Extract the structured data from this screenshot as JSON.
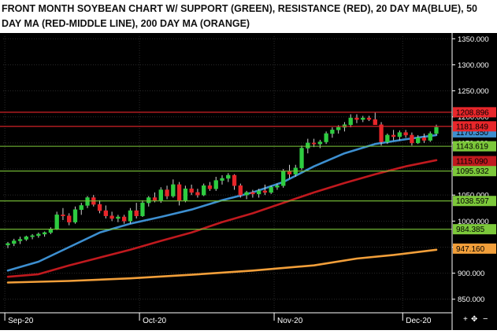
{
  "header": {
    "title": "FRONT MONTH SOYBEAN CHART W/ SUPPORT (GREEN), RESISTANCE (RED), 20 DAY MA(BLUE), 50 DAY MA (RED-MIDDLE LINE), 200 DAY MA (ORANGE)"
  },
  "chart_data": {
    "type": "candlestick",
    "title": "FRONT MONTH SOYBEAN CHART W/ SUPPORT (GREEN), RESISTANCE (RED), 20 DAY MA(BLUE), 50 DAY MA (RED-MIDDLE LINE), 200 DAY MA (ORANGE)",
    "ylim": [
      830,
      1355
    ],
    "y_ticks": [
      "850.000",
      "900.000",
      "950.000",
      "1000.000",
      "1050.000",
      "1100.000",
      "1150.000",
      "1200.000",
      "1250.000",
      "1300.000",
      "1350.000"
    ],
    "x_ticks": [
      {
        "label": "Sep-20",
        "index": 0
      },
      {
        "label": "Oct-20",
        "index": 22
      },
      {
        "label": "Nov-20",
        "index": 44
      },
      {
        "label": "Dec-20",
        "index": 65
      }
    ],
    "grid": true,
    "candle_up_color": "#2ecc40",
    "candle_down_color": "#e8262a",
    "candles": [
      [
        954,
        960,
        948,
        957
      ],
      [
        957,
        966,
        952,
        962
      ],
      [
        962,
        970,
        956,
        965
      ],
      [
        965,
        972,
        962,
        970
      ],
      [
        970,
        975,
        965,
        972
      ],
      [
        972,
        978,
        968,
        975
      ],
      [
        975,
        980,
        970,
        978
      ],
      [
        978,
        988,
        975,
        985
      ],
      [
        985,
        1018,
        983,
        1012
      ],
      [
        1012,
        1025,
        1002,
        1010
      ],
      [
        1010,
        1015,
        992,
        998
      ],
      [
        998,
        1028,
        995,
        1022
      ],
      [
        1022,
        1035,
        1012,
        1030
      ],
      [
        1030,
        1048,
        1025,
        1045
      ],
      [
        1045,
        1050,
        1028,
        1032
      ],
      [
        1032,
        1040,
        1015,
        1020
      ],
      [
        1020,
        1030,
        1005,
        1010
      ],
      [
        1010,
        1018,
        1000,
        1005
      ],
      [
        1005,
        1012,
        998,
        1008
      ],
      [
        1008,
        1012,
        995,
        1000
      ],
      [
        1000,
        1025,
        995,
        1020
      ],
      [
        1020,
        1035,
        1005,
        1010
      ],
      [
        1010,
        1040,
        1008,
        1035
      ],
      [
        1035,
        1048,
        1028,
        1045
      ],
      [
        1045,
        1055,
        1036,
        1040
      ],
      [
        1040,
        1065,
        1035,
        1060
      ],
      [
        1060,
        1068,
        1042,
        1048
      ],
      [
        1048,
        1080,
        1045,
        1070
      ],
      [
        1070,
        1075,
        1030,
        1040
      ],
      [
        1040,
        1068,
        1036,
        1062
      ],
      [
        1062,
        1070,
        1050,
        1055
      ],
      [
        1055,
        1062,
        1045,
        1050
      ],
      [
        1050,
        1072,
        1048,
        1068
      ],
      [
        1068,
        1075,
        1058,
        1062
      ],
      [
        1062,
        1085,
        1058,
        1078
      ],
      [
        1078,
        1088,
        1070,
        1082
      ],
      [
        1082,
        1092,
        1075,
        1088
      ],
      [
        1088,
        1090,
        1060,
        1068
      ],
      [
        1068,
        1072,
        1045,
        1050
      ],
      [
        1050,
        1058,
        1042,
        1055
      ],
      [
        1055,
        1060,
        1045,
        1052
      ],
      [
        1052,
        1062,
        1045,
        1058
      ],
      [
        1058,
        1070,
        1050,
        1055
      ],
      [
        1055,
        1068,
        1052,
        1065
      ],
      [
        1065,
        1072,
        1060,
        1068
      ],
      [
        1068,
        1100,
        1064,
        1095
      ],
      [
        1095,
        1108,
        1082,
        1090
      ],
      [
        1090,
        1108,
        1085,
        1102
      ],
      [
        1102,
        1145,
        1098,
        1140
      ],
      [
        1140,
        1158,
        1130,
        1150
      ],
      [
        1150,
        1158,
        1142,
        1148
      ],
      [
        1148,
        1156,
        1140,
        1152
      ],
      [
        1152,
        1172,
        1148,
        1168
      ],
      [
        1168,
        1180,
        1160,
        1175
      ],
      [
        1175,
        1184,
        1168,
        1180
      ],
      [
        1180,
        1190,
        1172,
        1185
      ],
      [
        1185,
        1205,
        1180,
        1198
      ],
      [
        1198,
        1205,
        1188,
        1195
      ],
      [
        1195,
        1202,
        1190,
        1198
      ],
      [
        1198,
        1202,
        1192,
        1195
      ],
      [
        1195,
        1208,
        1190,
        1185
      ],
      [
        1185,
        1190,
        1145,
        1152
      ],
      [
        1152,
        1168,
        1148,
        1165
      ],
      [
        1165,
        1175,
        1155,
        1162
      ],
      [
        1162,
        1174,
        1155,
        1170
      ],
      [
        1170,
        1175,
        1160,
        1165
      ],
      [
        1165,
        1170,
        1145,
        1150
      ],
      [
        1150,
        1165,
        1148,
        1160
      ],
      [
        1160,
        1168,
        1150,
        1155
      ],
      [
        1155,
        1172,
        1152,
        1168
      ],
      [
        1168,
        1185,
        1165,
        1180
      ]
    ],
    "moving_averages": [
      {
        "name": "20 DAY MA",
        "color": "#3d8fd0",
        "points": [
          [
            0,
            905
          ],
          [
            5,
            922
          ],
          [
            10,
            950
          ],
          [
            15,
            978
          ],
          [
            20,
            995
          ],
          [
            25,
            1008
          ],
          [
            30,
            1022
          ],
          [
            35,
            1040
          ],
          [
            40,
            1055
          ],
          [
            45,
            1075
          ],
          [
            50,
            1105
          ],
          [
            55,
            1130
          ],
          [
            60,
            1148
          ],
          [
            65,
            1157
          ],
          [
            70,
            1165
          ]
        ]
      },
      {
        "name": "50 DAY MA",
        "color": "#c0191e",
        "points": [
          [
            0,
            893
          ],
          [
            5,
            898
          ],
          [
            10,
            915
          ],
          [
            15,
            930
          ],
          [
            20,
            945
          ],
          [
            25,
            962
          ],
          [
            30,
            978
          ],
          [
            35,
            998
          ],
          [
            40,
            1015
          ],
          [
            45,
            1035
          ],
          [
            50,
            1055
          ],
          [
            55,
            1073
          ],
          [
            60,
            1090
          ],
          [
            65,
            1105
          ],
          [
            70,
            1117
          ]
        ]
      },
      {
        "name": "200 DAY MA",
        "color": "#f29f3a",
        "points": [
          [
            0,
            882
          ],
          [
            10,
            885
          ],
          [
            20,
            890
          ],
          [
            30,
            897
          ],
          [
            40,
            905
          ],
          [
            50,
            915
          ],
          [
            57,
            928
          ],
          [
            63,
            935
          ],
          [
            70,
            945
          ]
        ]
      }
    ],
    "resistance_lines": [
      {
        "value": 1208.896,
        "label": "1208.896",
        "color": "#e8262a"
      },
      {
        "value": 1181.849,
        "label": "1181.849",
        "color": "#e8262a"
      }
    ],
    "support_lines": [
      {
        "value": 1143.619,
        "label": "1143.619",
        "color": "#7cc83a"
      },
      {
        "value": 1095.932,
        "label": "1095.932",
        "color": "#7cc83a"
      },
      {
        "value": 1038.597,
        "label": "1038.597",
        "color": "#7cc83a"
      },
      {
        "value": 984.385,
        "label": "984.385",
        "color": "#7cc83a"
      }
    ],
    "value_tags": [
      {
        "value": 1170.35,
        "label": "1170.350",
        "color": "#3d8fd0"
      },
      {
        "value": 1115.09,
        "label": "1115.090",
        "color": "#c0191e"
      },
      {
        "value": 947.16,
        "label": "947.160",
        "color": "#f29f3a"
      }
    ]
  }
}
